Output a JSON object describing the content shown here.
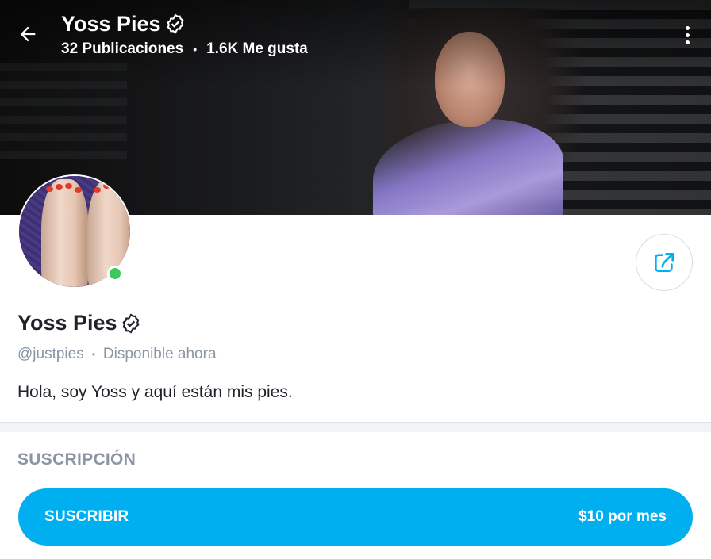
{
  "header": {
    "title": "Yoss Pies",
    "posts": "32 Publicaciones",
    "separator": "•",
    "likes": "1.6K Me gusta"
  },
  "profile": {
    "name": "Yoss Pies",
    "username": "@justpies",
    "separator": "•",
    "status": "Disponible ahora",
    "bio": "Hola, soy Yoss y aquí están mis pies."
  },
  "subscription": {
    "section_title": "SUSCRIPCIÓN",
    "button_label": "SUSCRIBIR",
    "price": "$10 por mes"
  },
  "colors": {
    "accent": "#00aff0",
    "online": "#3cc95f",
    "muted_text": "#8a96a3"
  },
  "icons": [
    "back-arrow-icon",
    "verified-badge-icon",
    "more-vertical-icon",
    "share-icon"
  ]
}
